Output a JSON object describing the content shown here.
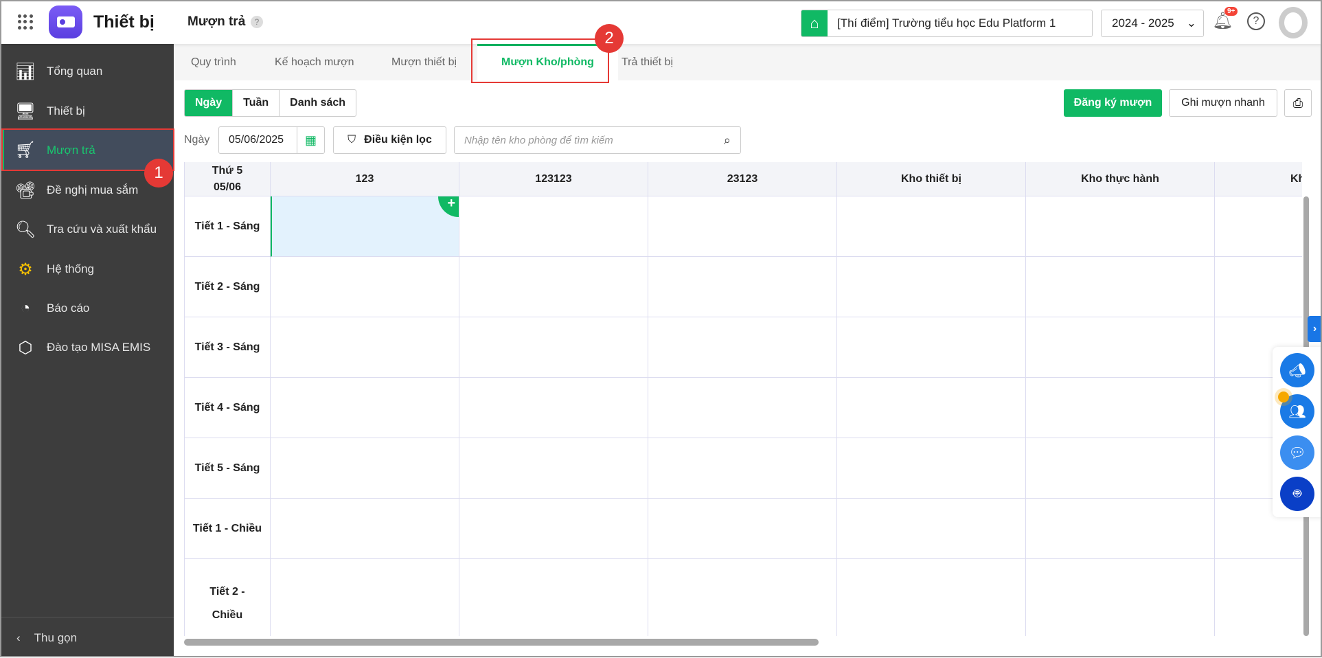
{
  "header": {
    "app_title": "Thiết bị",
    "page_title": "Mượn trả",
    "help": "?",
    "school": "[Thí điểm] Trường tiểu học Edu Platform 1",
    "year": "2024 - 2025",
    "notif_badge": "9+"
  },
  "sidebar": {
    "items": [
      {
        "label": "Tổng quan",
        "icon": "chart-bars-icon"
      },
      {
        "label": "Thiết bị",
        "icon": "monitor-icon"
      },
      {
        "label": "Mượn trả",
        "icon": "cart-icon",
        "active": true
      },
      {
        "label": "Đề nghị mua sắm",
        "icon": "projector-icon"
      },
      {
        "label": "Tra cứu và xuất khẩu",
        "icon": "search-icon"
      },
      {
        "label": "Hệ thống",
        "icon": "gear-icon"
      },
      {
        "label": "Báo cáo",
        "icon": "pie-chart-icon"
      },
      {
        "label": "Đào tạo MISA EMIS",
        "icon": "cube-icon"
      }
    ],
    "collapse": "Thu gọn"
  },
  "annotations": {
    "one": "1",
    "two": "2"
  },
  "tabs": [
    {
      "label": "Quy trình"
    },
    {
      "label": "Kế hoạch mượn"
    },
    {
      "label": "Mượn thiết bị"
    },
    {
      "label": "Mượn Kho/phòng",
      "active": true
    },
    {
      "label": "Trả thiết bị"
    }
  ],
  "views": [
    "Ngày",
    "Tuần",
    "Danh sách"
  ],
  "actions": {
    "register": "Đăng ký mượn",
    "quick": "Ghi mượn nhanh"
  },
  "filter": {
    "date_label": "Ngày",
    "date": "05/06/2025",
    "filter_button": "Điều kiện lọc",
    "search_placeholder": "Nhập tên kho phòng để tìm kiếm"
  },
  "schedule": {
    "corner": {
      "day": "Thứ 5",
      "date": "05/06"
    },
    "columns": [
      "123",
      "123123",
      "23123",
      "Kho thiết bị",
      "Kho thực hành",
      "Kho t"
    ],
    "rows": [
      "Tiết 1 - Sáng",
      "Tiết 2 - Sáng",
      "Tiết 3 - Sáng",
      "Tiết 4 - Sáng",
      "Tiết 5 - Sáng",
      "Tiết 1 - Chiều",
      "Tiết 2 - Chiều"
    ]
  },
  "colors": {
    "accent": "#10b964",
    "sidebar": "#3d3d3d",
    "annotation": "#e53935",
    "float_button": "#1a7ae6"
  }
}
